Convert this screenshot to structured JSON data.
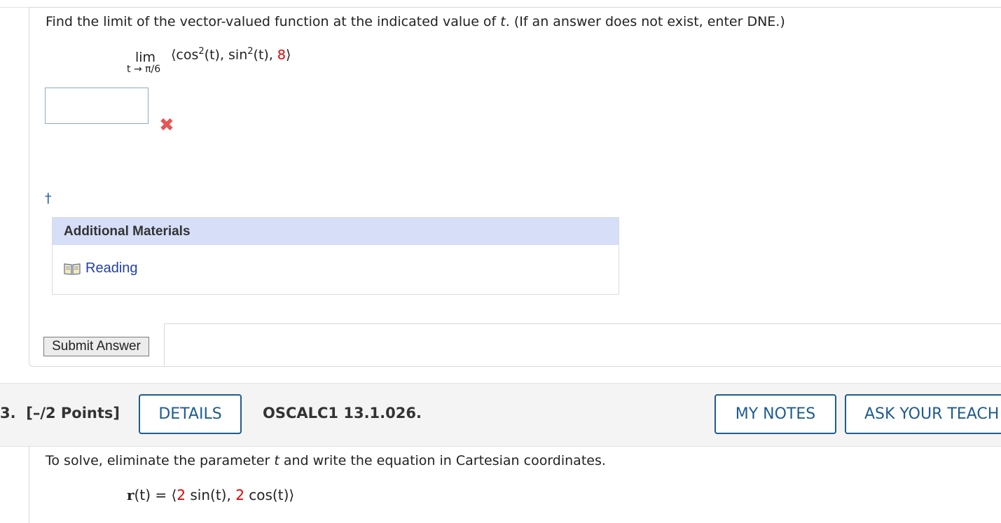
{
  "question2": {
    "prompt_pre": "Find the limit of the vector-valued function at the indicated value of ",
    "prompt_var": "t",
    "prompt_post": ". (If an answer does not exist, enter DNE.)",
    "lim_word": "lim",
    "lim_sub": "t → π/6",
    "vector_open": "⟨cos",
    "vector_exp1": "2",
    "vector_mid1": "(t), sin",
    "vector_exp2": "2",
    "vector_mid2": "(t), ",
    "vector_const": "8",
    "vector_close": "⟩",
    "answer_value": "",
    "incorrect_mark": "✖",
    "dagger": "†",
    "additional_materials_title": "Additional Materials",
    "reading_link": "Reading",
    "submit_label": "Submit Answer"
  },
  "question3": {
    "number": "3.",
    "points": "[–/2 Points]",
    "details_label": "DETAILS",
    "code": "OSCALC1 13.1.026.",
    "my_notes_label": "MY NOTES",
    "ask_teacher_label": "ASK YOUR TEACH",
    "prompt_pre": "To solve, eliminate the parameter ",
    "prompt_var": "t",
    "prompt_post": " and write the equation in Cartesian coordinates.",
    "eq_lhs": "r",
    "eq_arg": "(t)",
    "eq_eq": " = ⟨",
    "eq_c1": "2",
    "eq_f1": " sin(t), ",
    "eq_c2": "2",
    "eq_f2": " cos(t)",
    "eq_close": "⟩"
  },
  "colors": {
    "accent": "#1e5c8e",
    "red": "#e00000",
    "header_bg": "#d6def8",
    "link": "#1f3fb0"
  }
}
